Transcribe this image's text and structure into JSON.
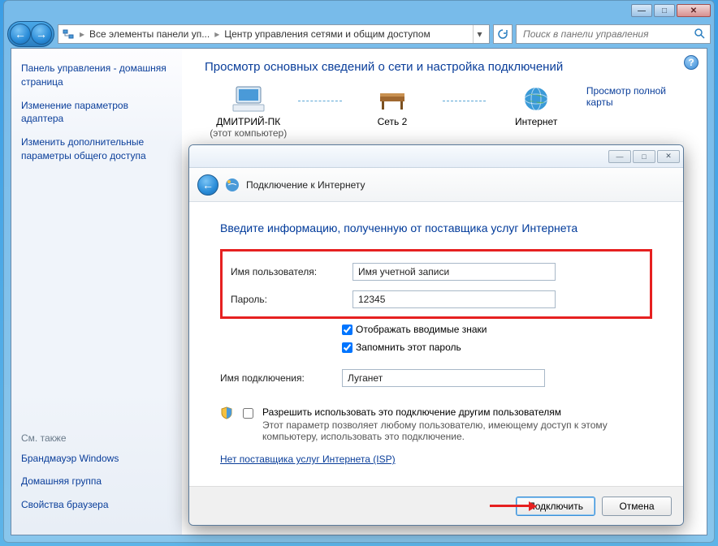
{
  "window": {
    "caption_minimize": "—",
    "caption_maximize": "□",
    "caption_close": "✕"
  },
  "nav": {
    "back": "←",
    "forward": "→",
    "breadcrumb1": "Все элементы панели уп...",
    "breadcrumb2": "Центр управления сетями и общим доступом",
    "search_placeholder": "Поиск в панели управления"
  },
  "sidebar": {
    "home": "Панель управления - домашняя страница",
    "link1": "Изменение параметров адаптера",
    "link2": "Изменить дополнительные параметры общего доступа",
    "see_also": "См. также",
    "link3": "Брандмауэр Windows",
    "link4": "Домашняя группа",
    "link5": "Свойства браузера"
  },
  "content": {
    "heading": "Просмотр основных сведений о сети и настройка подключений",
    "node1": "ДМИТРИЙ-ПК",
    "node1_sub": "(этот компьютер)",
    "node2": "Сеть 2",
    "node3": "Интернет",
    "full_map": "Просмотр полной карты"
  },
  "dialog": {
    "caption_minimize": "—",
    "caption_maximize": "□",
    "caption_close": "✕",
    "header_title": "Подключение к Интернету",
    "heading": "Введите информацию, полученную от поставщика услуг Интернета",
    "username_label": "Имя пользователя:",
    "username_value": "Имя учетной записи",
    "password_label": "Пароль:",
    "password_value": "12345",
    "show_chars": "Отображать вводимые знаки",
    "remember": "Запомнить этот пароль",
    "conn_name_label": "Имя подключения:",
    "conn_name_value": "Луганет",
    "allow_others": "Разрешить использовать это подключение другим пользователям",
    "allow_others_sub": "Этот параметр позволяет любому пользователю, имеющему доступ к этому компьютеру, использовать это подключение.",
    "isp_link": "Нет поставщика услуг Интернета (ISP)",
    "connect_btn": "Подключить",
    "cancel_btn": "Отмена"
  }
}
